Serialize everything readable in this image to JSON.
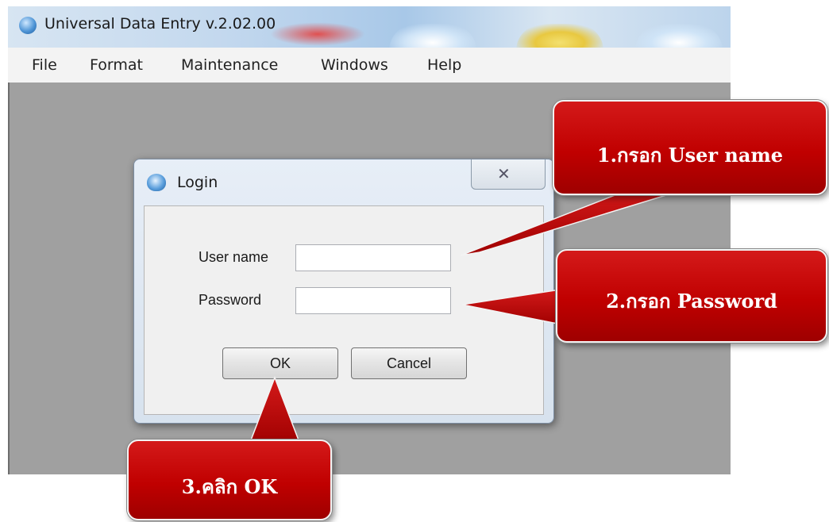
{
  "window": {
    "title": "Universal Data Entry v.2.02.00"
  },
  "menu": {
    "items": [
      "File",
      "Format",
      "Maintenance",
      "Windows",
      "Help"
    ]
  },
  "dialog": {
    "title": "Login",
    "close_glyph": "✕",
    "username": {
      "label": "User name",
      "value": "",
      "placeholder": ""
    },
    "password": {
      "label": "Password",
      "value": "",
      "placeholder": ""
    },
    "ok_label": "OK",
    "cancel_label": "Cancel"
  },
  "callouts": {
    "step1": "1.กรอก User name",
    "step2": "2.กรอก Password",
    "step3": "3.คลิก OK"
  },
  "colors": {
    "callout_red": "#c00000",
    "mdi_background": "#a0a0a0",
    "menubar": "#f3f3f3"
  },
  "icons": {
    "app": "app-logo-icon",
    "dialog": "login-logo-icon",
    "close": "close-icon"
  }
}
